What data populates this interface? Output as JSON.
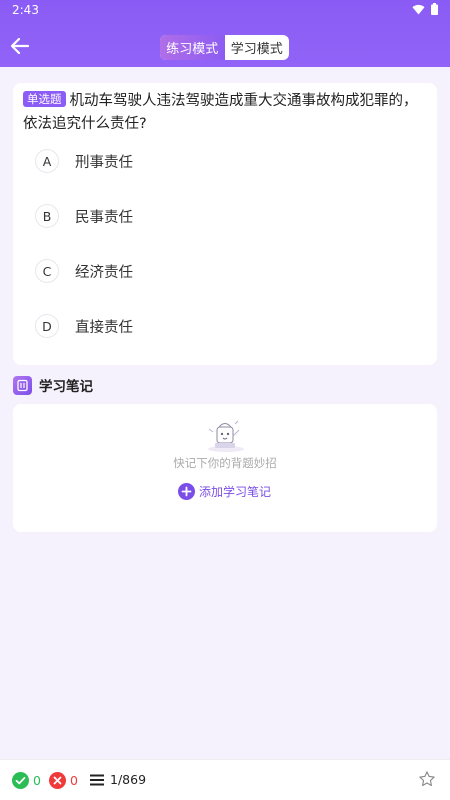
{
  "status_bar": {
    "time": "2:43"
  },
  "header": {
    "modes": [
      {
        "label": "练习模式",
        "active": true
      },
      {
        "label": "学习模式",
        "active": false
      }
    ]
  },
  "question": {
    "type_tag": "单选题",
    "text": "机动车驾驶人违法驾驶造成重大交通事故构成犯罪的，依法追究什么责任?",
    "options": [
      {
        "letter": "A",
        "text": "刑事责任"
      },
      {
        "letter": "B",
        "text": "民事责任"
      },
      {
        "letter": "C",
        "text": "经济责任"
      },
      {
        "letter": "D",
        "text": "直接责任"
      }
    ]
  },
  "notes": {
    "title": "学习笔记",
    "hint": "快记下你的背题妙招",
    "add_label": "添加学习笔记"
  },
  "bottom_bar": {
    "correct_count": "0",
    "wrong_count": "0",
    "progress": "1/869"
  },
  "colors": {
    "primary": "#8a5cf5",
    "correct": "#2bbd55",
    "wrong": "#f03a3a"
  }
}
